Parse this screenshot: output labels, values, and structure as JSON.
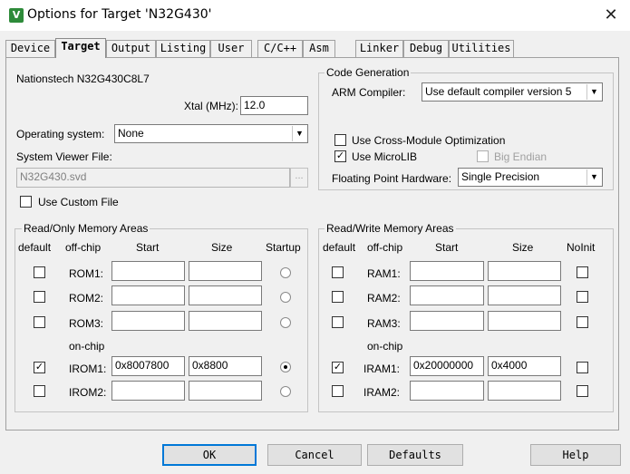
{
  "window": {
    "title": "Options for Target 'N32G430'",
    "icon": "keil-icon"
  },
  "tabs": [
    "Device",
    "Target",
    "Output",
    "Listing",
    "User",
    "C/C++",
    "Asm",
    "Linker",
    "Debug",
    "Utilities"
  ],
  "active_tab": "Target",
  "device_name": "Nationstech N32G430C8L7",
  "xtal": {
    "label": "Xtal (MHz):",
    "value": "12.0"
  },
  "os": {
    "label": "Operating system:",
    "value": "None"
  },
  "svd": {
    "label": "System Viewer File:",
    "value": "N32G430.svd",
    "browse": "..."
  },
  "use_custom_file": {
    "label": "Use Custom File",
    "checked": false
  },
  "codegen": {
    "title": "Code Generation",
    "compiler_label": "ARM Compiler:",
    "compiler_value": "Use default compiler version 5",
    "cross_module": {
      "label": "Use Cross-Module Optimization",
      "checked": false
    },
    "microlib": {
      "label": "Use MicroLIB",
      "checked": true
    },
    "big_endian": {
      "label": "Big Endian",
      "checked": false
    },
    "fpu_label": "Floating Point Hardware:",
    "fpu_value": "Single Precision"
  },
  "rom": {
    "title": "Read/Only Memory Areas",
    "headers": {
      "default": "default",
      "offchip": "off-chip",
      "start": "Start",
      "size": "Size",
      "startup": "Startup"
    },
    "onchip_label": "on-chip",
    "rows": [
      {
        "name": "ROM1:",
        "checked": false,
        "start": "",
        "size": "",
        "startup": false
      },
      {
        "name": "ROM2:",
        "checked": false,
        "start": "",
        "size": "",
        "startup": false
      },
      {
        "name": "ROM3:",
        "checked": false,
        "start": "",
        "size": "",
        "startup": false
      },
      {
        "name": "IROM1:",
        "checked": true,
        "start": "0x8007800",
        "size": "0x8800",
        "startup": true
      },
      {
        "name": "IROM2:",
        "checked": false,
        "start": "",
        "size": "",
        "startup": false
      }
    ]
  },
  "ram": {
    "title": "Read/Write Memory Areas",
    "headers": {
      "default": "default",
      "offchip": "off-chip",
      "start": "Start",
      "size": "Size",
      "noinit": "NoInit"
    },
    "onchip_label": "on-chip",
    "rows": [
      {
        "name": "RAM1:",
        "checked": false,
        "start": "",
        "size": "",
        "noinit": false
      },
      {
        "name": "RAM2:",
        "checked": false,
        "start": "",
        "size": "",
        "noinit": false
      },
      {
        "name": "RAM3:",
        "checked": false,
        "start": "",
        "size": "",
        "noinit": false
      },
      {
        "name": "IRAM1:",
        "checked": true,
        "start": "0x20000000",
        "size": "0x4000",
        "noinit": false
      },
      {
        "name": "IRAM2:",
        "checked": false,
        "start": "",
        "size": "",
        "noinit": false
      }
    ]
  },
  "buttons": {
    "ok": "OK",
    "cancel": "Cancel",
    "defaults": "Defaults",
    "help": "Help"
  }
}
